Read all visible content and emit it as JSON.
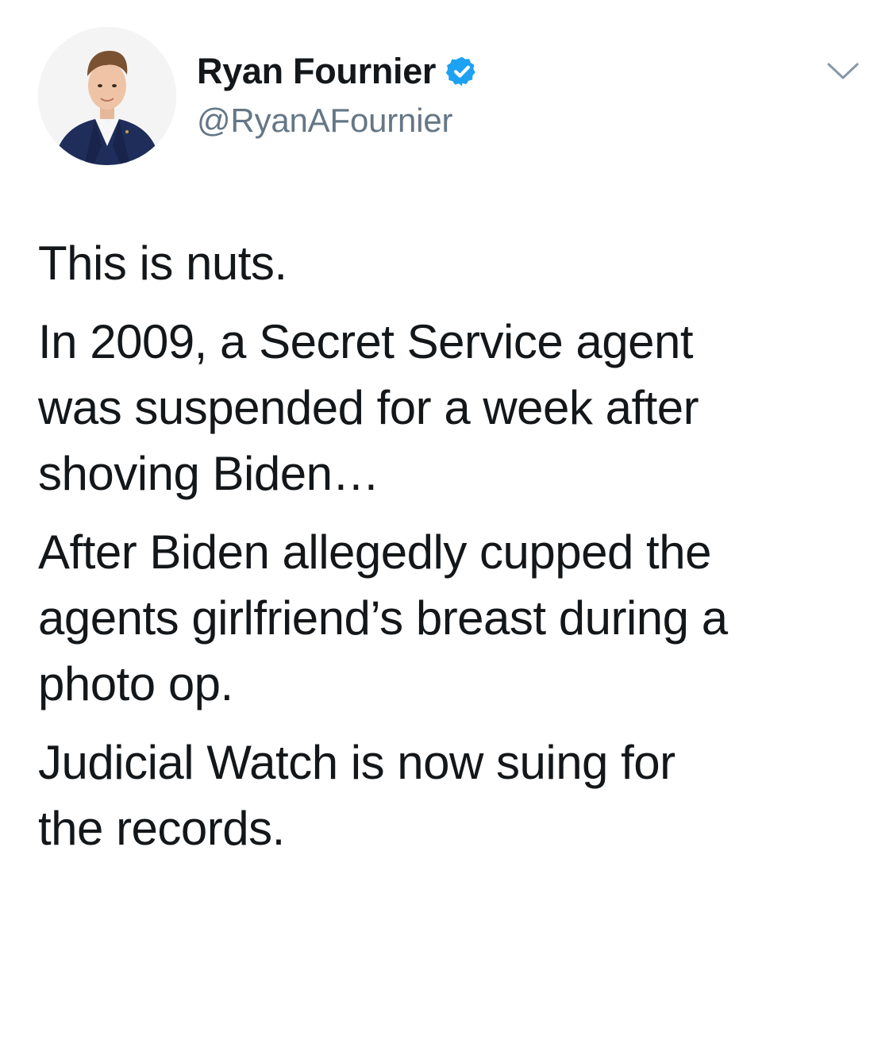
{
  "author": {
    "display_name": "Ryan Fournier",
    "handle": "@RyanAFournier",
    "verified": true,
    "avatar_icon": "profile-photo"
  },
  "menu": {
    "icon": "chevron-down-icon"
  },
  "tweet": {
    "paragraphs": [
      "This is nuts.",
      "In 2009, a Secret Service agent\nwas suspended for a week after\nshoving Biden…",
      "After Biden allegedly cupped the\nagents girlfriend’s breast during a\nphoto op.",
      "Judicial Watch is now suing for\nthe records."
    ]
  },
  "colors": {
    "text": "#14171a",
    "secondary_text": "#657786",
    "verified_blue": "#1da1f2",
    "chevron": "#8899a6",
    "background": "#ffffff"
  }
}
